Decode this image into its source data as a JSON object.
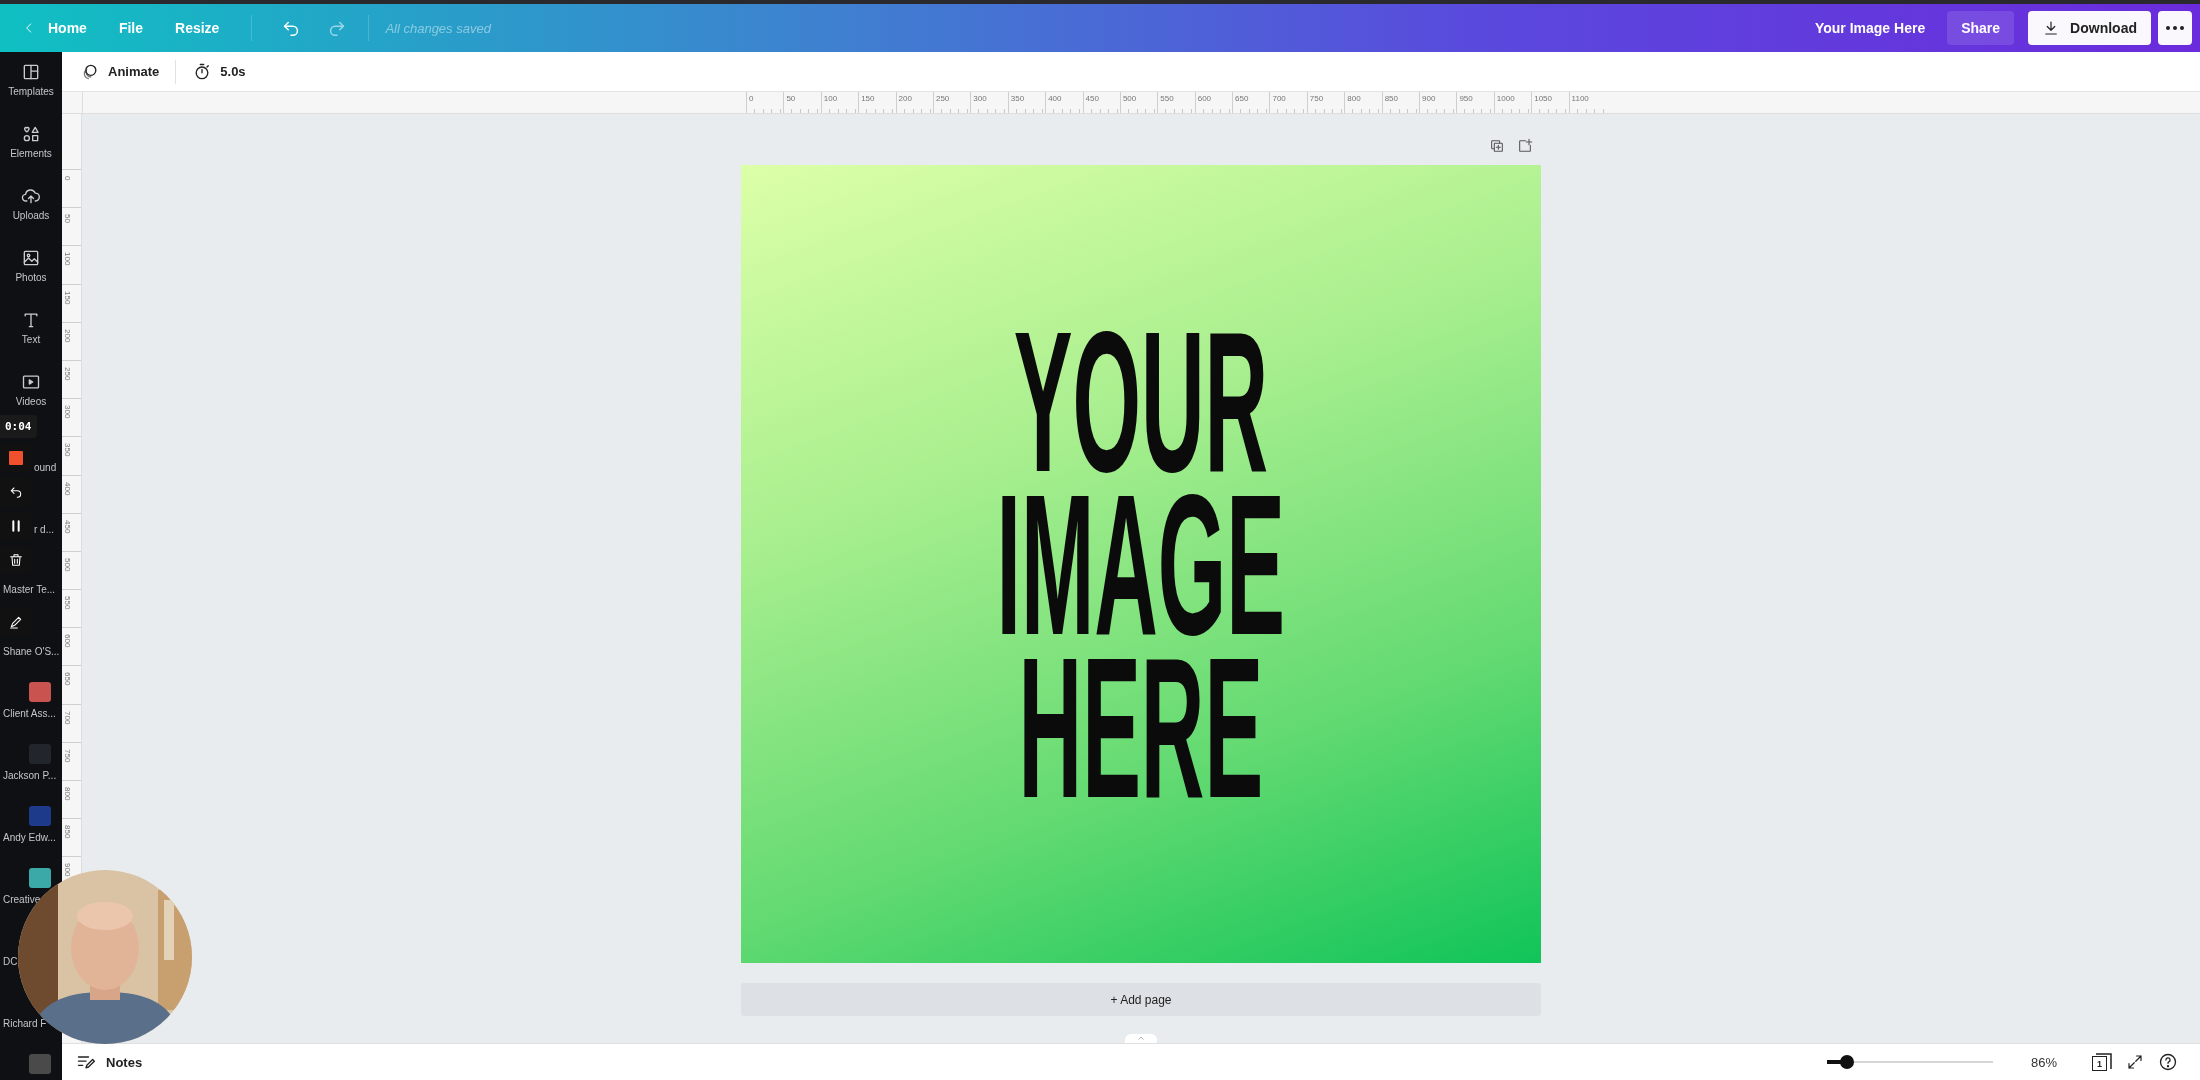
{
  "top_bar": {
    "nav": [
      {
        "label": "Home",
        "kind": "back"
      },
      {
        "label": "File",
        "kind": "plain"
      },
      {
        "label": "Resize",
        "kind": "plain"
      }
    ],
    "status": "All changes saved",
    "title": "Your Image Here",
    "share": "Share",
    "download": "Download"
  },
  "toolbar": {
    "animate": "Animate",
    "duration": "5.0s"
  },
  "sidebar": {
    "items": [
      {
        "label": "Templates",
        "kind": "templates"
      },
      {
        "label": "Elements",
        "kind": "elements"
      },
      {
        "label": "Uploads",
        "kind": "uploads"
      },
      {
        "label": "Photos",
        "kind": "photos"
      },
      {
        "label": "Text",
        "kind": "text"
      },
      {
        "label": "Videos",
        "kind": "videos"
      },
      {
        "label": "ound",
        "kind": "covered"
      },
      {
        "label": "r d...",
        "kind": "covered"
      },
      {
        "label": "Master Te...",
        "kind": "folder"
      },
      {
        "label": "Shane O'S...",
        "kind": "folder"
      },
      {
        "label": "Client Ass...",
        "kind": "thumbnail",
        "color": "#c9534f"
      },
      {
        "label": "Jackson P...",
        "kind": "thumbnail",
        "color": "#22252c"
      },
      {
        "label": "Andy Edw...",
        "kind": "thumbnail",
        "color": "#1d3a8a"
      },
      {
        "label": "Creative",
        "kind": "thumbnail",
        "color": "#3aa9a8"
      },
      {
        "label": "DC",
        "kind": "folder"
      },
      {
        "label": "Richard F",
        "kind": "folder"
      },
      {
        "kind": "thumbnail",
        "color": "#4a4a4a"
      }
    ]
  },
  "recorder": {
    "time": "0:04"
  },
  "rulers": {
    "horizontal": [
      "0",
      "50",
      "100",
      "150",
      "200",
      "250",
      "300",
      "350",
      "400",
      "450",
      "500",
      "550",
      "600",
      "650",
      "700",
      "750",
      "800",
      "850",
      "900",
      "950",
      "1000",
      "1050",
      "1100"
    ],
    "vertical": [
      "0",
      "50",
      "100",
      "150",
      "200",
      "250",
      "300",
      "350",
      "400",
      "450",
      "500",
      "550",
      "600",
      "650",
      "700",
      "750",
      "800",
      "850",
      "900"
    ]
  },
  "design": {
    "lines": [
      "YOUR",
      "IMAGE",
      "HERE"
    ]
  },
  "add_page": "+ Add page",
  "bottom_bar": {
    "notes": "Notes",
    "zoom": {
      "level": 0.12
    },
    "zoom_reading": "86%",
    "page_count": "1"
  }
}
